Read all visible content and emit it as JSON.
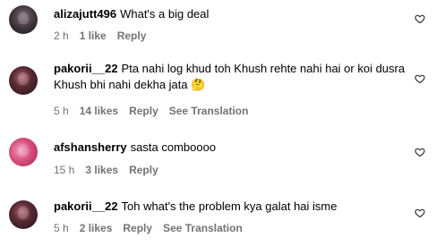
{
  "comments": [
    {
      "username": "alizajutt496",
      "text": "What's a big deal",
      "time": "2 h",
      "likes": "1 like",
      "reply": "Reply"
    },
    {
      "username": "pakorii__22",
      "text": "Pta nahi log khud toh Khush rehte nahi hai or koi dusra Khush bhi nahi dekha jata 🤔",
      "time": "5 h",
      "likes": "14 likes",
      "reply": "Reply",
      "translation": "See Translation"
    },
    {
      "username": "afshansherry",
      "text": "sasta comboooo",
      "time": "15 h",
      "likes": "3 likes",
      "reply": "Reply"
    },
    {
      "username": "pakorii__22",
      "text": "Toh what's the problem kya galat hai isme",
      "time": "5 h",
      "likes": "2 likes",
      "reply": "Reply",
      "translation": "See Translation"
    }
  ],
  "icons": {
    "like": "heart-outline-icon"
  }
}
